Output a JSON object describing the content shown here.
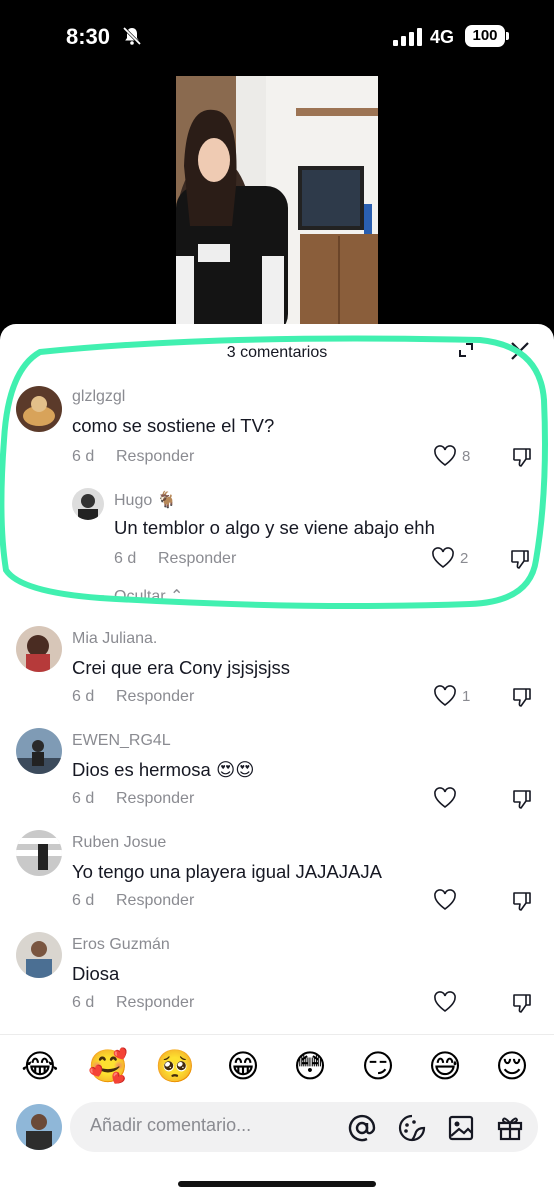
{
  "status_bar": {
    "time": "8:30",
    "network": "4G",
    "battery": "100"
  },
  "sheet": {
    "title": "3 comentarios"
  },
  "comments": [
    {
      "username": "glzlgzgl",
      "text": "como se sostiene el TV?",
      "age": "6 d",
      "reply_label": "Responder",
      "likes": "8"
    },
    {
      "username": "Hugo 🐐",
      "text": "Un temblor o algo y se viene abajo ehh",
      "age": "6 d",
      "reply_label": "Responder",
      "likes": "2"
    },
    {
      "username": "Mia Juliana.",
      "text": "Crei que era Cony jsjsjsjss",
      "age": "6 d",
      "reply_label": "Responder",
      "likes": "1"
    },
    {
      "username": "EWEN_RG4L",
      "text": "Dios es hermosa 😍😍",
      "age": "6 d",
      "reply_label": "Responder",
      "likes": ""
    },
    {
      "username": "Ruben Josue",
      "text": "Yo tengo una playera igual JAJAJAJA",
      "age": "6 d",
      "reply_label": "Responder",
      "likes": ""
    },
    {
      "username": "Eros Guzmán",
      "text": "Diosa",
      "age": "6 d",
      "reply_label": "Responder",
      "likes": ""
    }
  ],
  "thread": {
    "hide_label": "Ocultar"
  },
  "emoji_bar": [
    "😂",
    "🥰",
    "🥺",
    "😁",
    "😳",
    "😏",
    "😅",
    "😌"
  ],
  "composer": {
    "placeholder": "Añadir comentario...",
    "tools": [
      "at-icon",
      "sticker-icon",
      "image-icon",
      "gift-icon"
    ]
  },
  "colors": {
    "highlight_stroke": "#41f0b0",
    "secondary_text": "#8a8b91"
  }
}
